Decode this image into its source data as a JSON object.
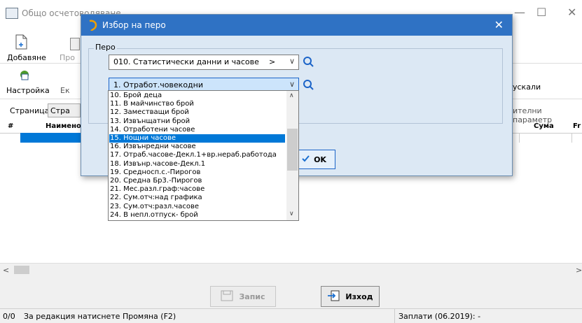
{
  "window": {
    "title": "Общо осчетоводяване",
    "minimize": "—",
    "maximize": "☐",
    "close": "✕"
  },
  "toolbar": {
    "add_label": "Добавяне",
    "change_label": "Про",
    "settings_label": "Настройка",
    "export_label": "Ек",
    "right_label": "ускали"
  },
  "page_row": {
    "label": "Страница:",
    "value": "Стра",
    "right_label": "ителни параметр"
  },
  "table": {
    "headers": [
      "#",
      "Наимено",
      "Сума",
      "Fr"
    ]
  },
  "buttons": {
    "save": "Запис",
    "exit": "Изход"
  },
  "status": {
    "count": "0/0",
    "hint": "За редакция натиснете Промяна (F2)",
    "salary": "Заплати (06.2019): -"
  },
  "dialog": {
    "title": "Избор на перо",
    "close": "✕",
    "group_label": "Перо",
    "combo1_value": "010. Статистически данни и часове",
    "combo1_suffix": ">",
    "combo2_value": "1. Отработ.човекодни",
    "ok_label": "OK"
  },
  "dropdown": {
    "items": [
      "10. Брой деца",
      "11. В майчинство брой",
      "12. Заместващи брой",
      "13. Извънщатни брой",
      "14. Отработени часове",
      "15. Нощни часове",
      "16. Извънредни часове",
      "17. Отраб.часове-Декл.1+вр.нераб.работода",
      "18. Извънр.часове-Декл.1",
      "19. Средносп.с.-Пирогов",
      "20. Средна Бр3.-Пирогов",
      "21. Мес.разл.граф:часове",
      "22. Сум.отч:над графика",
      "23. Сум.отч:разл.часове",
      "24. В непл.отпуск- брой"
    ],
    "selected_index": 5
  },
  "colors": {
    "dialog_title": "#2f72c4",
    "dialog_bg": "#dce8f4",
    "selection": "#0078d7"
  }
}
